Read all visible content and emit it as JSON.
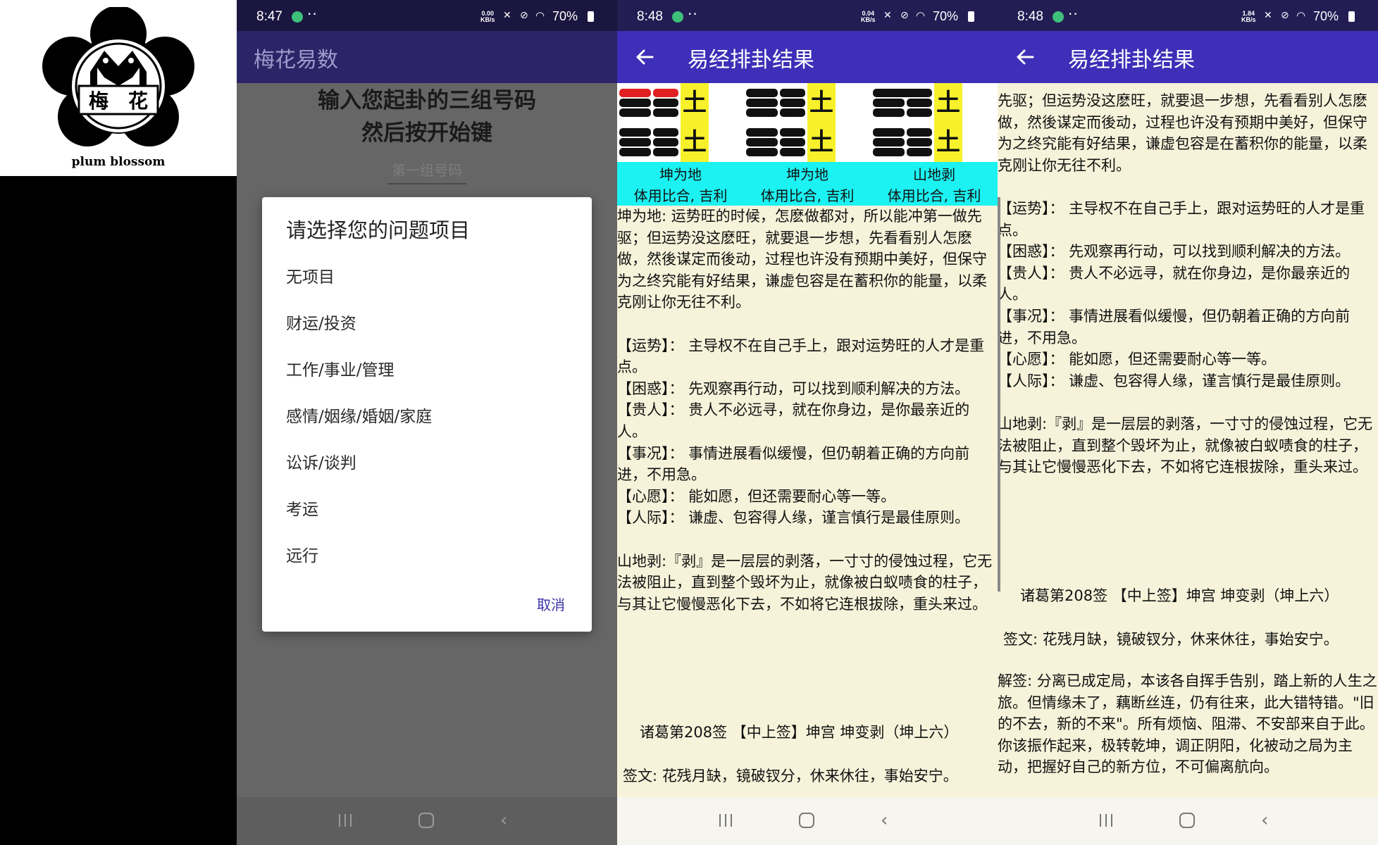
{
  "logo": {
    "char_left": "梅",
    "char_right": "花",
    "caption": "plum blossom"
  },
  "phone1": {
    "status": {
      "time": "8:47",
      "speed_top": "0.00",
      "speed_bottom": "KB/s",
      "battery": "70%"
    },
    "app_title": "梅花易数",
    "prompt_line1": "输入您起卦的三组号码",
    "prompt_line2": "然后按开始键",
    "input_placeholder": "第一组号码",
    "dialog": {
      "title": "请选择您的问题项目",
      "options": [
        "无项目",
        "财运/投资",
        "工作/事业/管理",
        "感情/姻缘/婚姻/家庭",
        "讼诉/谈判",
        "考运",
        "远行"
      ],
      "cancel": "取消"
    }
  },
  "phone2": {
    "status": {
      "time": "8:48",
      "speed_top": "0.04",
      "speed_bottom": "KB/s",
      "battery": "70%"
    },
    "title": "易经排卦结果",
    "hexagrams": [
      {
        "name": "坤为地",
        "relation": "体用比合, 吉利",
        "element": "土"
      },
      {
        "name": "坤为地",
        "relation": "体用比合, 吉利",
        "element": "土"
      },
      {
        "name": "山地剥",
        "relation": "体用比合, 吉利",
        "element": "土"
      }
    ],
    "body": "坤为地: 运势旺的时候，怎麽做都对，所以能冲第一做先驱；但运势没这麽旺，就要退一步想，先看看别人怎麽做，然後谋定而後动，过程也许没有预期中美好，但保守为之终究能有好结果，谦虚包容是在蓄积你的能量，以柔克刚让你无往不利。\n\n【运势】： 主导权不在自己手上，跟对运势旺的人才是重点。\n【困惑】： 先观察再行动，可以找到顺利解决的方法。\n【贵人】： 贵人不必远寻，就在你身边，是你最亲近的人。\n【事况】： 事情进展看似缓慢，但仍朝着正确的方向前进，不用急。\n【心愿】： 能如愿，但还需要耐心等一等。\n【人际】： 谦虚、包容得人缘，谨言慎行是最佳原则。\n\n山地剥:『剥』是一层层的剥落，一寸寸的侵蚀过程，它无法被阻止，直到整个毁坏为止，就像被白蚁啧食的柱子，与其让它慢慢恶化下去，不如将它连根拔除，重头来过。",
    "sign_title": "诸葛第208签 【中上签】坤宫 坤变剥（坤上六）",
    "sign_text": "签文: 花残月缺，镜破钗分，休来休往，事始安宁。"
  },
  "phone3": {
    "status": {
      "time": "8:48",
      "speed_top": "1.84",
      "speed_bottom": "KB/s",
      "battery": "70%"
    },
    "title": "易经排卦结果",
    "body": "先驱；但运势没这麽旺，就要退一步想，先看看别人怎麽做，然後谋定而後动，过程也许没有预期中美好，但保守为之终究能有好结果，谦虚包容是在蓄积你的能量，以柔克刚让你无往不利。\n\n【运势】： 主导权不在自己手上，跟对运势旺的人才是重点。\n【困惑】： 先观察再行动，可以找到顺利解决的方法。\n【贵人】： 贵人不必远寻，就在你身边，是你最亲近的人。\n【事况】： 事情进展看似缓慢，但仍朝着正确的方向前进，不用急。\n【心愿】： 能如愿，但还需要耐心等一等。\n【人际】： 谦虚、包容得人缘，谨言慎行是最佳原则。\n\n山地剥:『剥』是一层层的剥落，一寸寸的侵蚀过程，它无法被阻止，直到整个毁坏为止，就像被白蚁啧食的柱子，与其让它慢慢恶化下去，不如将它连根拔除，重头来过。",
    "sign_title": "诸葛第208签 【中上签】坤宫 坤变剥（坤上六）",
    "sign_text": "签文: 花残月缺，镜破钗分，休来休往，事始安宁。",
    "explain": "解签: 分离已成定局，本该各自挥手告别，踏上新的人生之旅。但情缘未了，藕断丝连，仍有往来，此大错特错。\"旧的不去，新的不来\"。所有烦恼、阻滞、不安部来自于此。你该振作起来，极转乾坤，调正阴阳，化被动之局为主动，把握好自己的新方位，不可偏离航向。"
  },
  "colors": {
    "accent": "#3d2fb8",
    "yang_line": "#111111",
    "changing_line": "#e02020",
    "earth_block": "#f7f12c",
    "label_band": "#1cf2f2",
    "paper": "#f6f3da"
  }
}
